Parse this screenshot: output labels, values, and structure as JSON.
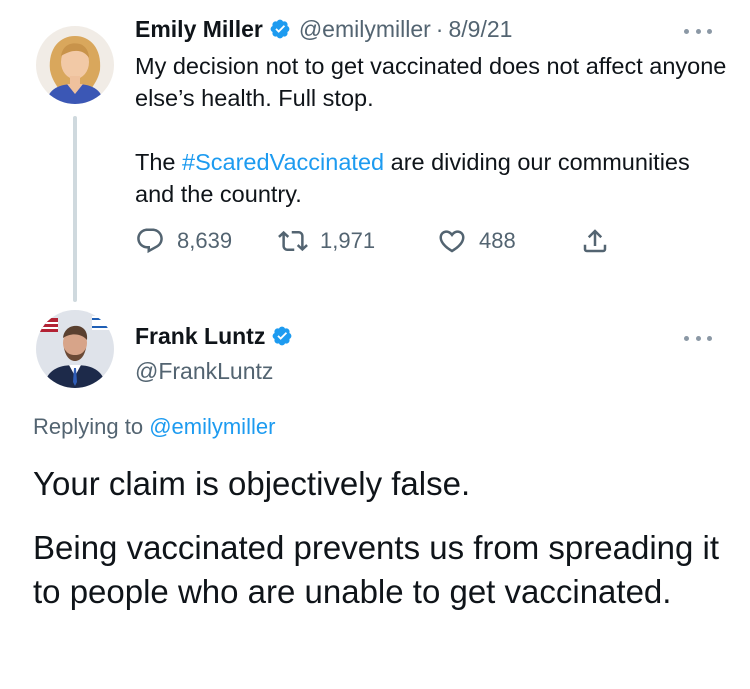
{
  "original_tweet": {
    "author_name": "Emily Miller",
    "author_handle": "@emilymiller",
    "separator": "·",
    "date": "8/9/21",
    "text_line1": "My decision not to get vaccinated does not affect anyone else’s health. Full stop.",
    "text_p2_before": "The ",
    "hashtag": "#ScaredVaccinated",
    "text_p2_after": " are dividing our communities and the country.",
    "stats": {
      "replies": "8,639",
      "retweets": "1,971",
      "likes": "488"
    }
  },
  "reply_tweet": {
    "author_name": "Frank Luntz",
    "author_handle": "@FrankLuntz",
    "replying_prefix": "Replying to ",
    "replying_to": "@emilymiller",
    "paragraph1": "Your claim is objectively false.",
    "paragraph2": "Being vaccinated prevents us from spreading it to people who are unable to get vaccinated."
  },
  "icons": {
    "verified": "verified-badge-icon",
    "more": "more-options-icon",
    "reply": "reply-icon",
    "retweet": "retweet-icon",
    "like": "heart-icon",
    "share": "share-icon"
  },
  "colors": {
    "accent": "#1d9bf0",
    "secondary_text": "#536471",
    "primary_text": "#0f1419",
    "thread_line": "#cfd9de"
  }
}
